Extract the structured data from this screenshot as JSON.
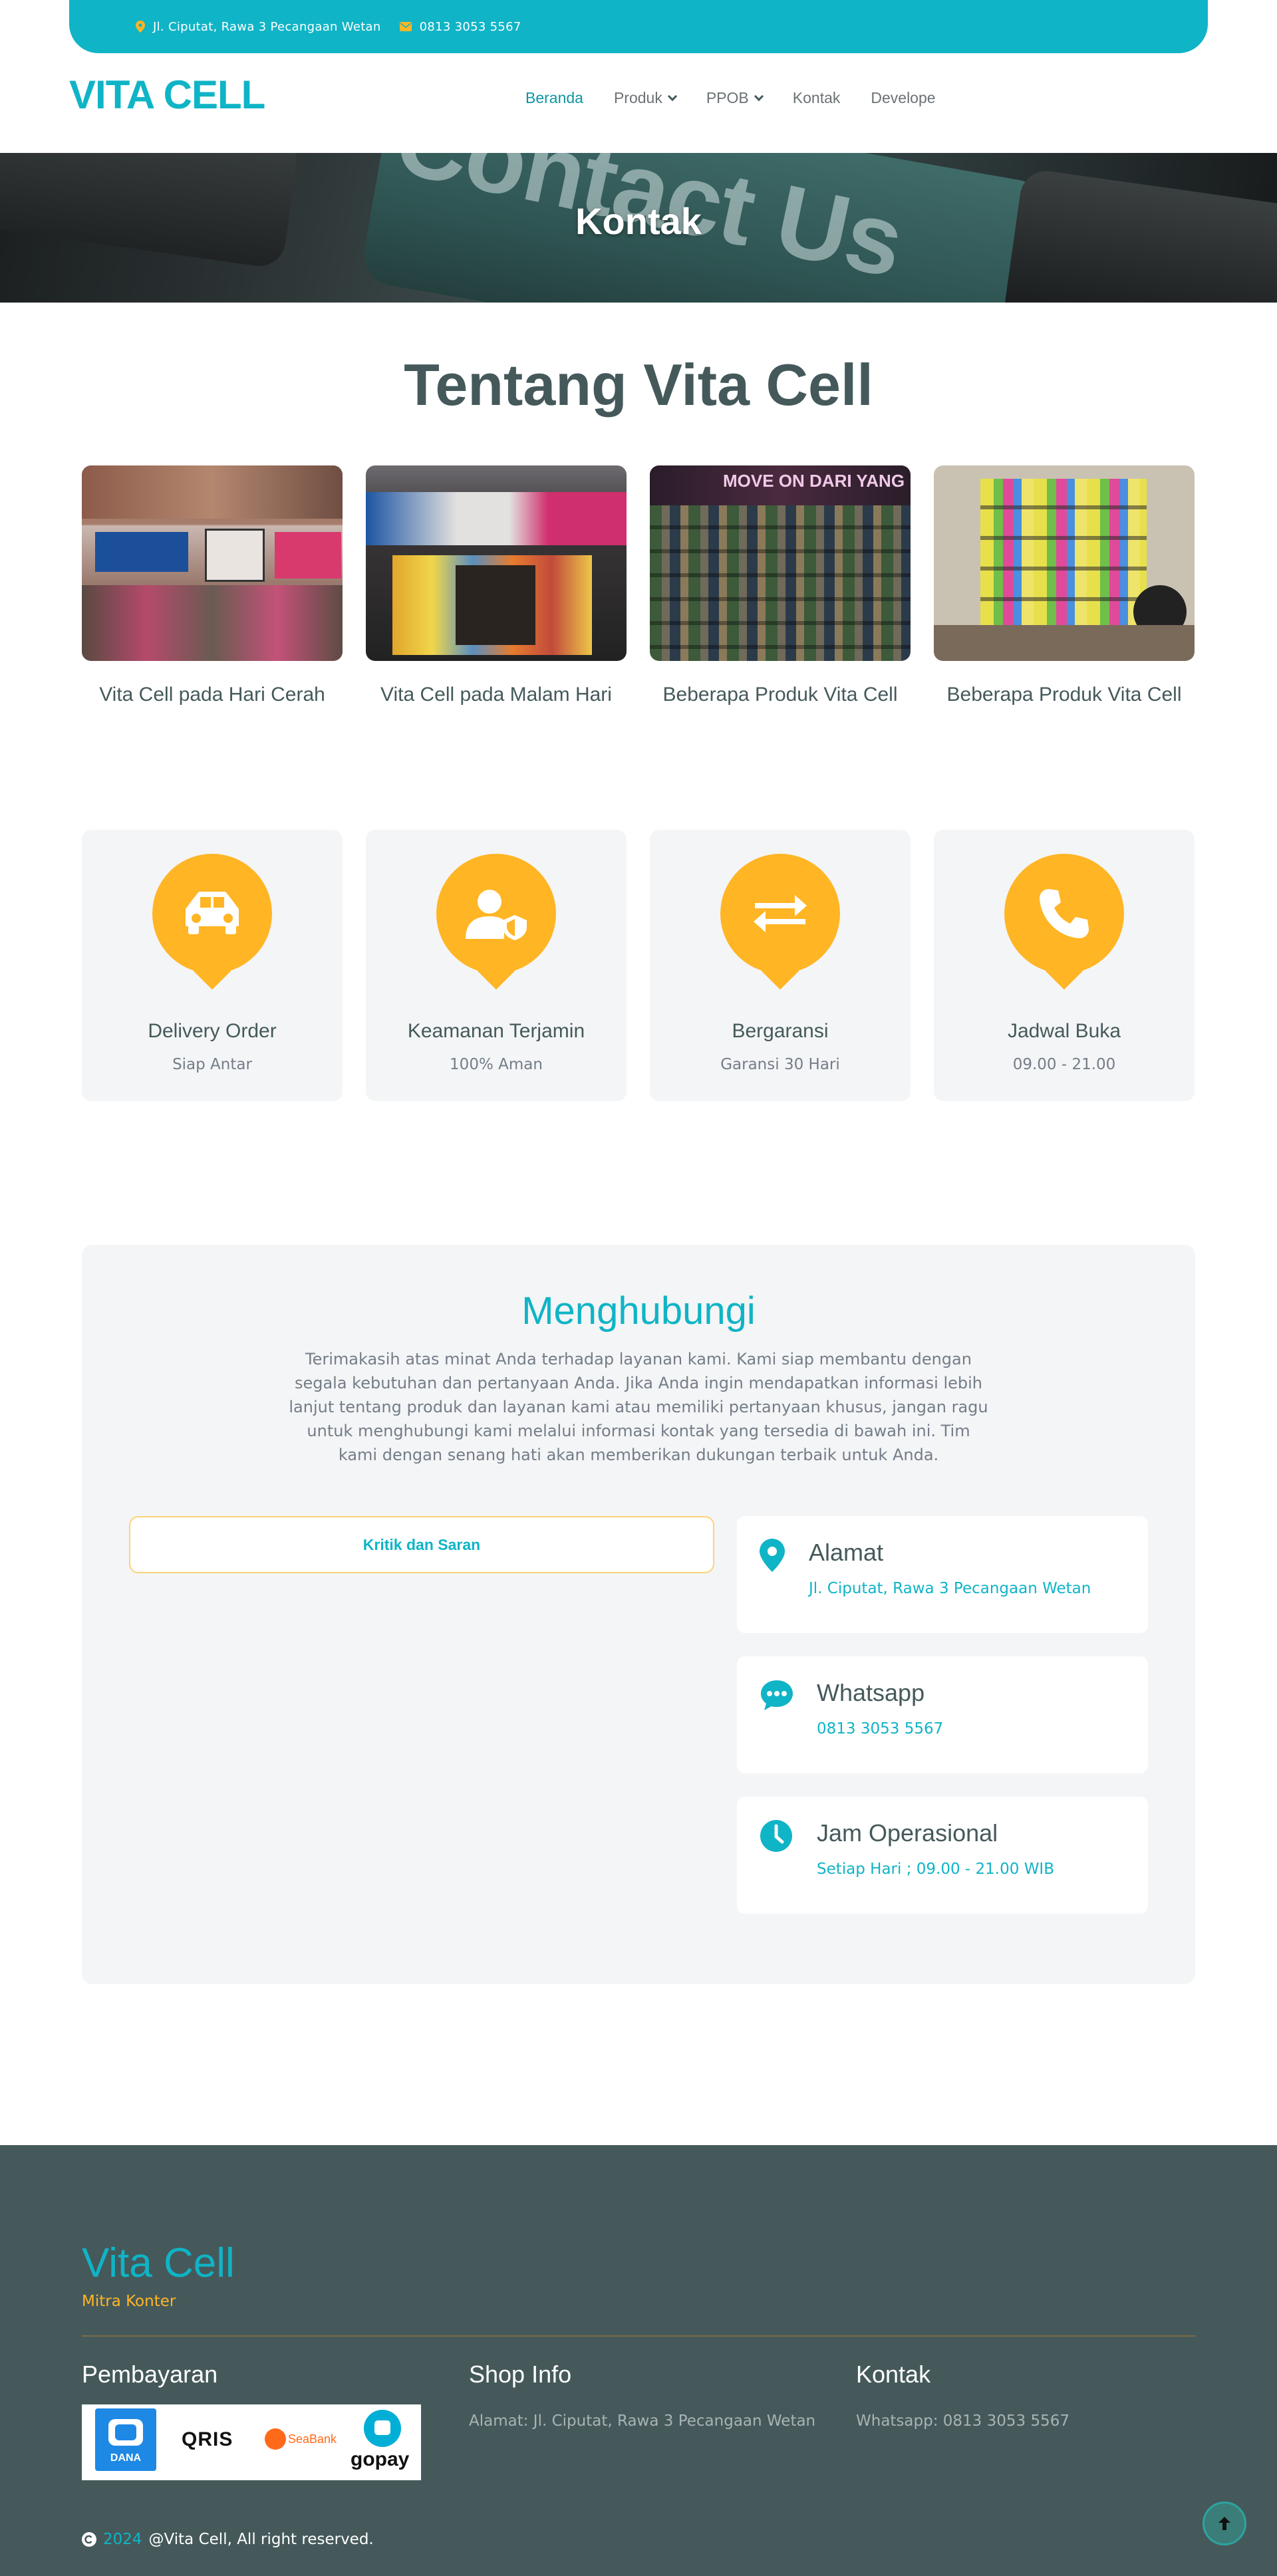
{
  "topbar": {
    "address": "Jl. Ciputat, Rawa 3 Pecangaan Wetan",
    "phone": "0813 3053 5567"
  },
  "nav": {
    "brand": "VITA CELL",
    "items": [
      {
        "label": "Beranda",
        "active": true
      },
      {
        "label": "Produk",
        "dropdown": true
      },
      {
        "label": "PPOB",
        "dropdown": true
      },
      {
        "label": "Kontak"
      },
      {
        "label": "Develope"
      }
    ]
  },
  "hero": {
    "title": "Kontak",
    "background_text": "Contact Us"
  },
  "about": {
    "title": "Tentang Vita Cell",
    "cards": [
      {
        "caption": "Vita Cell pada Hari Cerah"
      },
      {
        "caption": "Vita Cell pada Malam Hari"
      },
      {
        "caption": "Beberapa Produk Vita Cell"
      },
      {
        "caption": "Beberapa Produk Vita Cell"
      }
    ]
  },
  "features": [
    {
      "title": "Delivery Order",
      "subtitle": "Siap Antar",
      "icon": "car-icon"
    },
    {
      "title": "Keamanan Terjamin",
      "subtitle": "100% Aman",
      "icon": "user-shield-icon"
    },
    {
      "title": "Bergaransi",
      "subtitle": "Garansi 30 Hari",
      "icon": "exchange-arrows-icon"
    },
    {
      "title": "Jadwal Buka",
      "subtitle": "09.00 - 21.00",
      "icon": "phone-icon"
    }
  ],
  "contact": {
    "title": "Menghubungi",
    "description": "Terimakasih atas minat Anda terhadap layanan kami. Kami siap membantu dengan segala kebutuhan dan pertanyaan Anda. Jika Anda ingin mendapatkan informasi lebih lanjut tentang produk dan layanan kami atau memiliki pertanyaan khusus, jangan ragu untuk menghubungi kami melalui informasi kontak yang tersedia di bawah ini. Tim kami dengan senang hati akan memberikan dukungan terbaik untuk Anda.",
    "feedback_button": "Kritik dan Saran",
    "info": [
      {
        "title": "Alamat",
        "value": "Jl. Ciputat, Rawa 3 Pecangaan Wetan",
        "icon": "map-pin-icon"
      },
      {
        "title": "Whatsapp",
        "value": "0813 3053 5567",
        "icon": "chat-icon"
      },
      {
        "title": "Jam Operasional",
        "value": "Setiap Hari ; 09.00 - 21.00 WIB",
        "icon": "clock-icon"
      }
    ]
  },
  "footer": {
    "brand": "Vita Cell",
    "tagline": "Mitra Konter",
    "payment_title": "Pembayaran",
    "payment_logos": [
      "DANA",
      "QRIS",
      "SeaBank",
      "gopay"
    ],
    "shop_title": "Shop Info",
    "shop_text": "Alamat: Jl. Ciputat, Rawa 3 Pecangaan Wetan",
    "contact_title": "Kontak",
    "contact_text": "Whatsapp: 0813 3053 5567",
    "copyright_year": "2024",
    "copyright_text": "@Vita Cell, All right reserved."
  },
  "colors": {
    "accent": "#0fb4c6",
    "secondary": "#ffb524",
    "dark": "#45595b",
    "light_bg": "#f4f5f6"
  }
}
